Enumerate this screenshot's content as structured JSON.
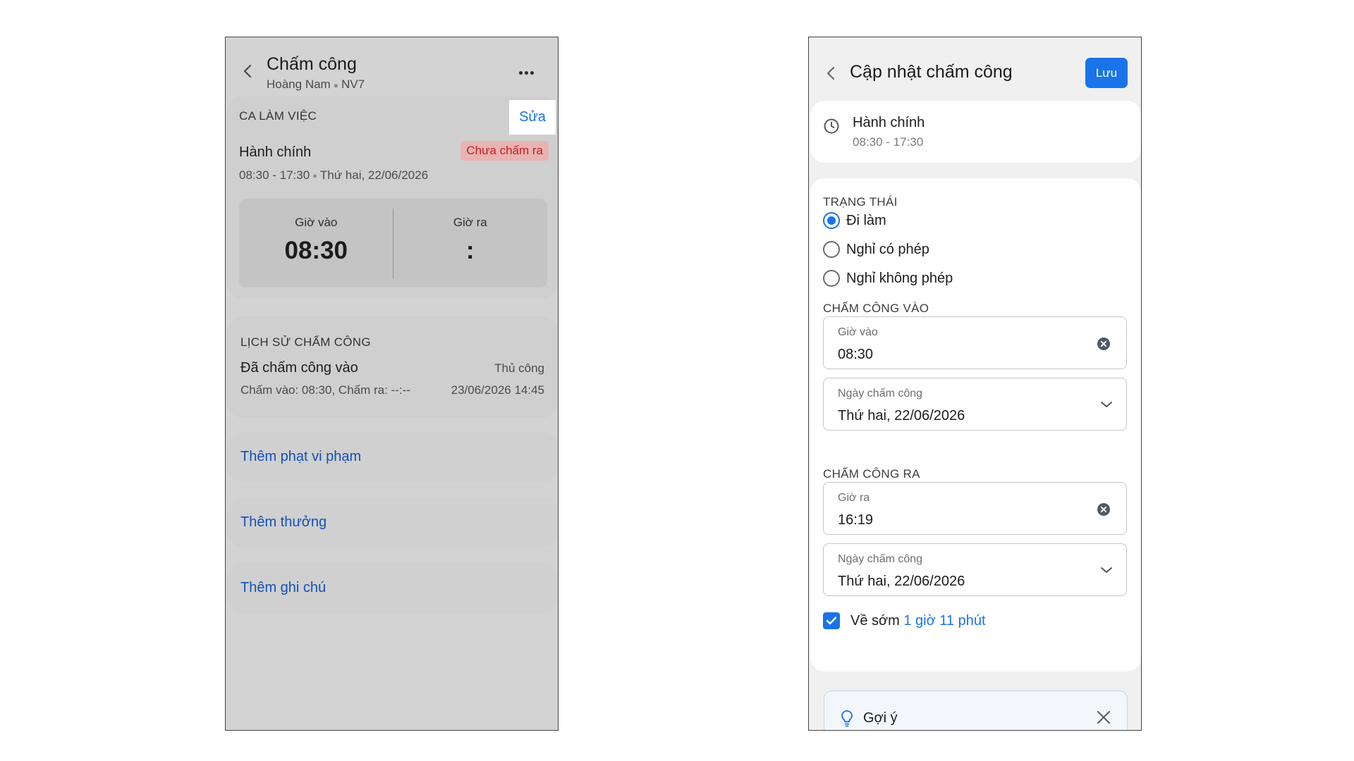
{
  "left": {
    "header": {
      "title": "Chấm công",
      "employee_name": "Hoàng Nam",
      "employee_code": "NV7"
    },
    "shift_card": {
      "section_label": "CA LÀM VIỆC",
      "edit_label": "Sửa",
      "shift_name": "Hành chính",
      "status_badge": "Chưa chấm ra",
      "shift_hours": "08:30 - 17:30",
      "shift_date": "Thứ hai, 22/06/2026",
      "clock_in_label": "Giờ vào",
      "clock_in_value": "08:30",
      "clock_out_label": "Giờ ra",
      "clock_out_value": ":"
    },
    "history": {
      "title": "LỊCH SỬ CHẤM CÔNG",
      "event": "Đã chấm công vào",
      "method": "Thủ công",
      "detail": "Chấm vào: 08:30, Chấm ra: --:--",
      "timestamp": "23/06/2026 14:45"
    },
    "actions": {
      "add_penalty": "Thêm phạt vi phạm",
      "add_bonus": "Thêm thưởng",
      "add_note": "Thêm ghi chú"
    }
  },
  "right": {
    "header": {
      "title": "Cập nhật chấm công",
      "save_label": "Lưu"
    },
    "shift": {
      "name": "Hành chính",
      "hours": "08:30 - 17:30"
    },
    "status": {
      "label": "TRẠNG THÁI",
      "options": [
        "Đi làm",
        "Nghỉ có phép",
        "Nghỉ không phép"
      ],
      "selected": "Đi làm"
    },
    "clock_in": {
      "label": "CHẤM CÔNG VÀO",
      "time_label": "Giờ vào",
      "time_value": "08:30",
      "date_label": "Ngày chấm công",
      "date_value": "Thứ hai, 22/06/2026"
    },
    "clock_out": {
      "label": "CHẤM CÔNG RA",
      "time_label": "Giờ ra",
      "time_value": "16:19",
      "date_label": "Ngày chấm công",
      "date_value": "Thứ hai, 22/06/2026"
    },
    "early_leave": {
      "checked": true,
      "label": "Về sớm",
      "hours": "1 giờ",
      "minutes": "11 phút"
    },
    "hint": {
      "title": "Gợi ý"
    }
  },
  "colors": {
    "accent": "#1a73e8",
    "badge_text": "#c02020",
    "badge_bg": "#e9b3b3",
    "action_link": "#1451b5"
  },
  "icons": [
    "chevron-left-icon",
    "more-horizontal-icon",
    "clock-icon",
    "clear-circle-icon",
    "chevron-down-icon",
    "check-icon",
    "lightbulb-icon",
    "close-icon"
  ]
}
